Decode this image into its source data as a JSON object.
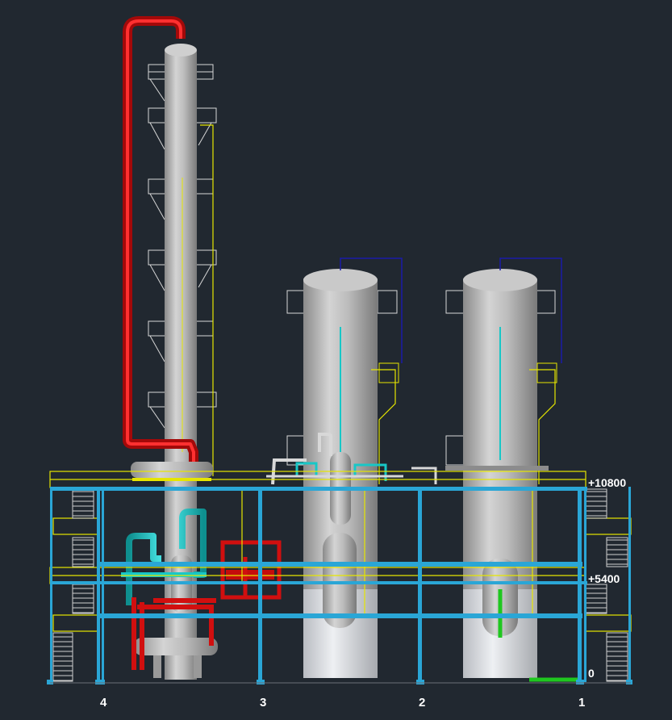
{
  "elevations": {
    "top": "+10800",
    "mid": "+5400",
    "ground": "0"
  },
  "grid_axes": [
    "4",
    "3",
    "2",
    "1"
  ],
  "colors": {
    "background": "#212830",
    "vessel": "#a9a9a9",
    "frame_blue": "#2aa6d6",
    "structure_yellow": "#e6e600",
    "pipe_red": "#d10f0f",
    "pipe_cyan": "#18c7c7",
    "pipe_green": "#1fc71f",
    "pipe_navy": "#1b1ba8",
    "ladder_white": "#d8d8d8"
  }
}
